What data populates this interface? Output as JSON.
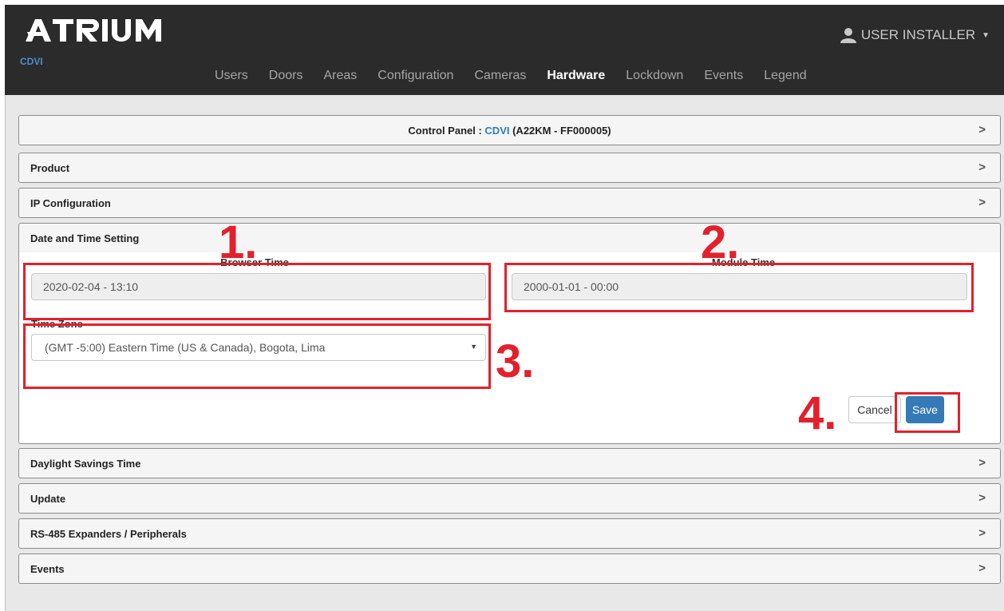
{
  "header": {
    "logo_text": "ATRIUM",
    "brand": "CDVI",
    "user_label": "USER INSTALLER",
    "nav": [
      {
        "label": "Users"
      },
      {
        "label": "Doors"
      },
      {
        "label": "Areas"
      },
      {
        "label": "Configuration"
      },
      {
        "label": "Cameras"
      },
      {
        "label": "Hardware",
        "active": true
      },
      {
        "label": "Lockdown"
      },
      {
        "label": "Events"
      },
      {
        "label": "Legend"
      }
    ]
  },
  "control_panel": {
    "prefix": "Control Panel : ",
    "name": "CDVI",
    "suffix": " (A22KM - FF000005)"
  },
  "sections": {
    "product": "Product",
    "ip_configuration": "IP Configuration",
    "date_time": "Date and Time Setting",
    "daylight": "Daylight Savings Time",
    "update": "Update",
    "rs485": "RS-485 Expanders / Peripherals",
    "events": "Events"
  },
  "date_time": {
    "browser_time_label": "Browser Time",
    "browser_time_value": "2020-02-04 - 13:10",
    "module_time_label": "Module Time",
    "module_time_value": "2000-01-01 - 00:00",
    "time_zone_label": "Time Zone",
    "time_zone_value": "(GMT -5:00) Eastern Time (US & Canada), Bogota, Lima",
    "cancel_label": "Cancel",
    "save_label": "Save"
  },
  "annotations": {
    "n1": "1.",
    "n2": "2.",
    "n3": "3.",
    "n4": "4."
  },
  "colors": {
    "header_bg": "#2b2b2b",
    "accent_blue": "#337ab7",
    "annotation_red": "#e3202c"
  }
}
